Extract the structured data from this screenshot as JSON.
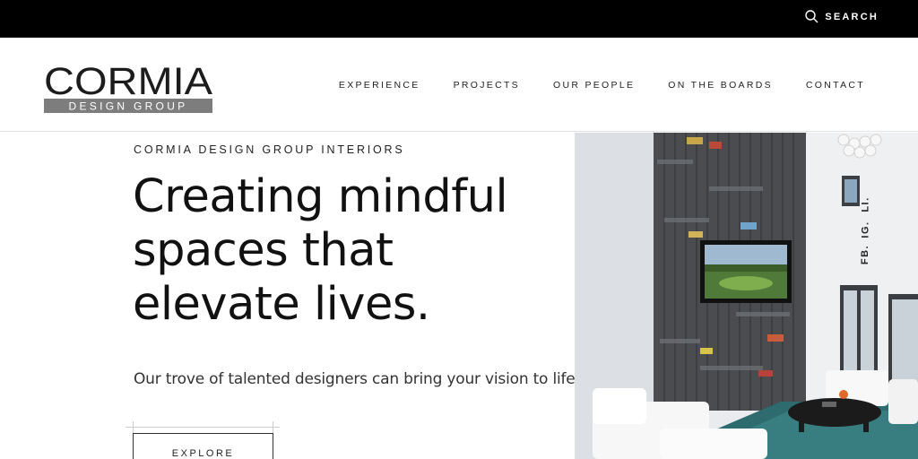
{
  "topbar": {
    "search_label": "SEARCH",
    "search_icon": "search-icon"
  },
  "header": {
    "logo": {
      "wordmark": "CORMIA",
      "subline": "DESIGN GROUP"
    },
    "nav": [
      {
        "label": "EXPERIENCE"
      },
      {
        "label": "PROJECTS"
      },
      {
        "label": "OUR PEOPLE"
      },
      {
        "label": "ON THE BOARDS"
      },
      {
        "label": "CONTACT"
      }
    ]
  },
  "hero": {
    "eyebrow": "CORMIA DESIGN GROUP INTERIORS",
    "headline_line1": "Creating mindful",
    "headline_line2": "spaces that",
    "headline_line3": "elevate lives.",
    "subtext": "Our trove of talented designers can bring your vision to life",
    "cta_label": "EXPLORE"
  },
  "social": {
    "links": [
      {
        "label": "FB."
      },
      {
        "label": "IG."
      },
      {
        "label": "LI."
      }
    ]
  },
  "colors": {
    "topbar": "#000000",
    "logo_sub_bg": "#7d7d7d",
    "text": "#111111"
  }
}
